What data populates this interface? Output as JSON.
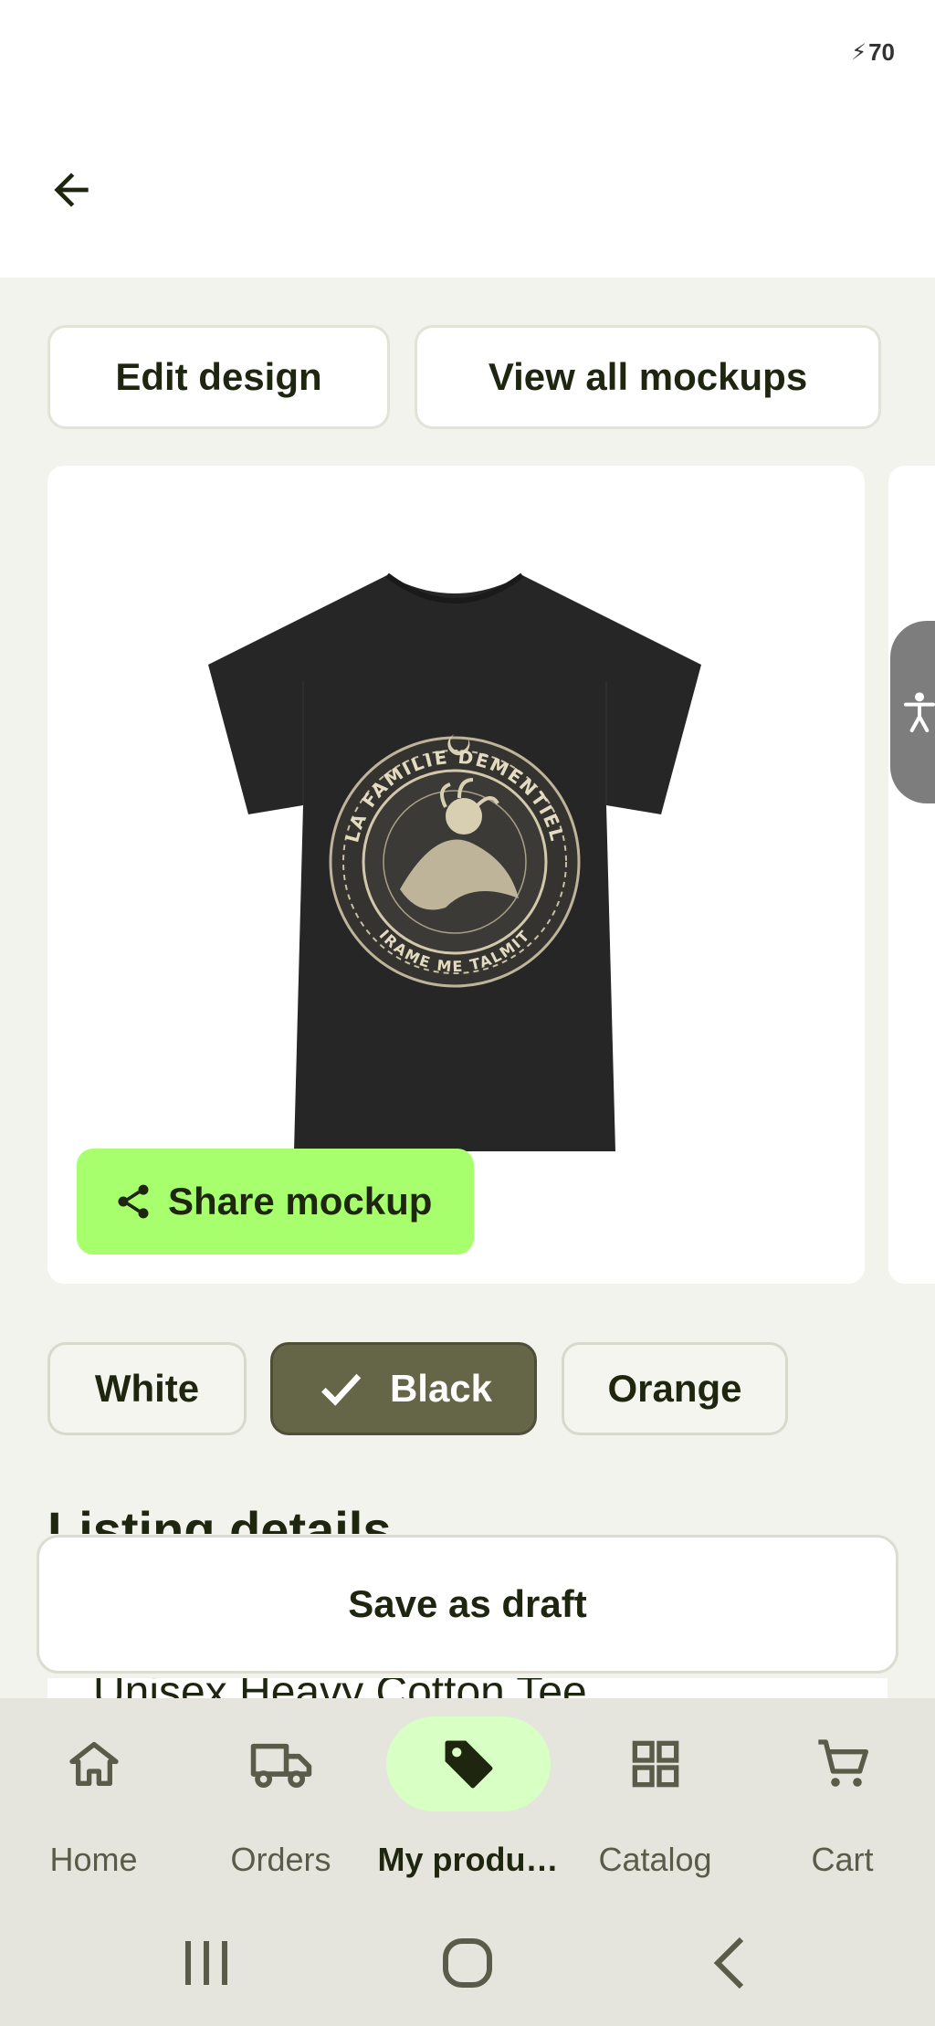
{
  "status": {
    "battery": "70"
  },
  "actions": {
    "edit_design": "Edit design",
    "view_all_mockups": "View all mockups"
  },
  "mockup": {
    "share_label": "Share mockup",
    "print_text_top": "LA FAMILIE DEMENTIEL",
    "print_text_bottom": "IRAME ME TALMIT"
  },
  "colors": {
    "options": [
      "White",
      "Black",
      "Orange"
    ],
    "selected": "Black"
  },
  "listing": {
    "section_title": "Listing details",
    "product_title_preview": "Unisex Heavy Cotton Tee"
  },
  "save_draft": "Save as draft",
  "nav": {
    "items": [
      {
        "label": "Home",
        "icon": "home-icon"
      },
      {
        "label": "Orders",
        "icon": "truck-icon"
      },
      {
        "label": "My produ…",
        "icon": "tag-icon",
        "active": true
      },
      {
        "label": "Catalog",
        "icon": "grid-icon"
      },
      {
        "label": "Cart",
        "icon": "cart-icon"
      }
    ]
  },
  "theme": {
    "accent": "#a8ff6e",
    "selected_chip": "#656548",
    "nav_active": "#d8ffc4"
  }
}
